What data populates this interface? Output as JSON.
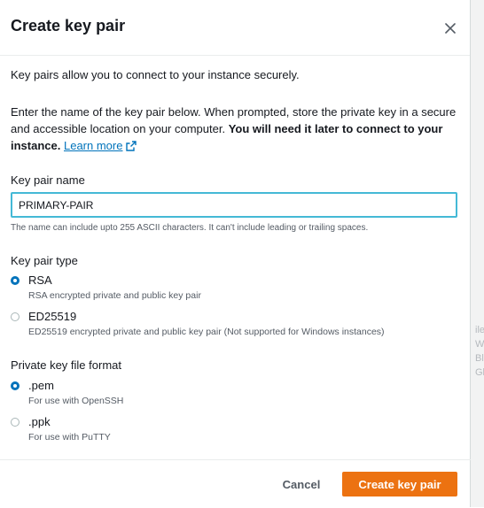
{
  "dialog": {
    "title": "Create key pair",
    "intro": "Key pairs allow you to connect to your instance securely.",
    "description_part1": "Enter the name of the key pair below. When prompted, store the private key in a secure and accessible location on your computer. ",
    "description_bold": "You will need it later to connect to your instance.",
    "learn_more": "Learn more"
  },
  "key_pair_name": {
    "label": "Key pair name",
    "value": "PRIMARY-PAIR",
    "hint": "The name can include upto 255 ASCII characters. It can't include leading or trailing spaces."
  },
  "key_pair_type": {
    "label": "Key pair type",
    "options": [
      {
        "label": "RSA",
        "description": "RSA encrypted private and public key pair",
        "selected": true
      },
      {
        "label": "ED25519",
        "description": "ED25519 encrypted private and public key pair (Not supported for Windows instances)",
        "selected": false
      }
    ]
  },
  "file_format": {
    "label": "Private key file format",
    "options": [
      {
        "label": ".pem",
        "description": "For use with OpenSSH",
        "selected": true
      },
      {
        "label": ".ppk",
        "description": "For use with PuTTY",
        "selected": false
      }
    ]
  },
  "footer": {
    "cancel_label": "Cancel",
    "create_label": "Create key pair"
  },
  "background_fragments": [
    "ile",
    "W",
    "Bl",
    "Gl"
  ],
  "icons": {
    "close": "close-icon",
    "external_link": "external-link-icon"
  },
  "colors": {
    "accent": "#0073bb",
    "primary_button": "#ec7211",
    "focus_border": "#44b9d6"
  }
}
